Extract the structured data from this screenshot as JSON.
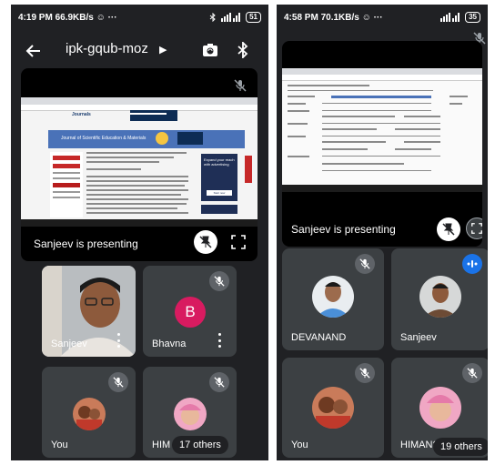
{
  "left": {
    "status": {
      "left_text": "4:19 PM 66.9KB/s ☺ ···",
      "battery": "51"
    },
    "meeting_code": "ipk-gqub-moz",
    "presentation": {
      "label": "Sanjeev is presenting",
      "webpage": {
        "site": "Journals",
        "banner_title": "Journal of Scientific Education & Materials",
        "ad_text": "Expand your reach with advertising",
        "ad_button": "Start now"
      }
    },
    "tiles": [
      {
        "name": "Sanjeev"
      },
      {
        "name": "Bhavna",
        "initial": "B"
      },
      {
        "name": "You"
      },
      {
        "name": "HIM",
        "others": "17 others"
      }
    ]
  },
  "right": {
    "status": {
      "left_text": "4:58 PM 70.1KB/s ☺ ···",
      "battery": "35"
    },
    "presentation": {
      "label": "Sanjeev is presenting"
    },
    "tiles": [
      {
        "name": "DEVANAND"
      },
      {
        "name": "Sanjeev"
      },
      {
        "name": "You"
      },
      {
        "name": "HIMANS",
        "others": "19 others"
      }
    ]
  },
  "colors": {
    "background": "#202124",
    "tile": "#3c4043",
    "bhavna_avatar": "#d81b60",
    "speaking_indicator": "#1a73e8"
  }
}
